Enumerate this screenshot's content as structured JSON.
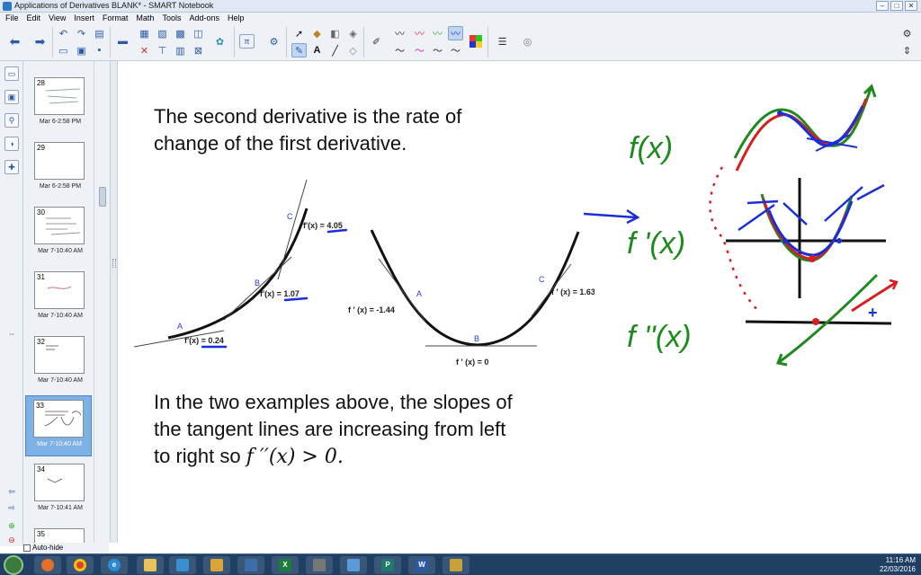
{
  "window": {
    "title": "Applications of Derivatives BLANK* - SMART Notebook",
    "buttons": [
      "–",
      "□",
      "✕"
    ]
  },
  "menu": {
    "items": [
      "File",
      "Edit",
      "View",
      "Insert",
      "Format",
      "Math",
      "Tools",
      "Add-ons",
      "Help"
    ]
  },
  "toolbar": {
    "tools": [
      "back",
      "forward",
      "undo",
      "redo",
      "add-page",
      "delete",
      "open",
      "save",
      "paste",
      "print",
      "screen-shade",
      "full-screen",
      "table",
      "capture",
      "math-tools",
      "insert",
      "select",
      "fill",
      "eraser-pen",
      "text",
      "line",
      "shapes",
      "pen",
      "calligraphic",
      "creative",
      "colors",
      "properties",
      "settings"
    ]
  },
  "sorter": {
    "pages": [
      {
        "num": "28",
        "time": "Mar 6-2:58 PM"
      },
      {
        "num": "29",
        "time": "Mar 6-2:58 PM"
      },
      {
        "num": "30",
        "time": "Mar 7-10:40 AM"
      },
      {
        "num": "31",
        "time": "Mar 7-10:40 AM"
      },
      {
        "num": "32",
        "time": "Mar 7-10:40 AM"
      },
      {
        "num": "33",
        "time": "Mar 7-10:40 AM"
      },
      {
        "num": "34",
        "time": "Mar 7-10:41 AM"
      },
      {
        "num": "35",
        "time": ""
      }
    ],
    "active_page": "33",
    "auto_hide": "Auto-hide"
  },
  "slide": {
    "heading_line1": "The second derivative is the rate of",
    "heading_line2": "change of the first derivative.",
    "graph1": {
      "label_a": "A",
      "label_b": "B",
      "label_c": "C",
      "slope_a": "f'(x) = 0.24",
      "slope_b": "f'(x) = 1.07",
      "slope_c": "f'(x) = 4.05"
    },
    "graph2": {
      "label_a": "A",
      "label_b": "B",
      "label_c": "C",
      "slope_a": "f ' (x) = -1.44",
      "slope_b": "f ' (x) = 0",
      "slope_c": "f ' (x) = 1.63"
    },
    "handwritten": {
      "f": "f(x)",
      "f_prime": "f '(x)",
      "f_double_prime": "f ''(x)",
      "plus": "+"
    },
    "bottom_line1": "In the two examples above, the slopes of",
    "bottom_line2": "the tangent lines are increasing from left",
    "bottom_line3_prefix": "to right so ",
    "bottom_math": "f ′′(x) > 0.",
    "ink_colors": {
      "blue": "#1b2fd6",
      "green": "#1e8a1e",
      "red": "#d61f1f"
    }
  },
  "taskbar": {
    "time": "11:16 AM",
    "date": "22/03/2016",
    "apps": [
      "firefox",
      "chrome",
      "ie",
      "explorer",
      "smart-apps",
      "notebook",
      "excel",
      "files",
      "notepad",
      "publisher",
      "word",
      "smart-ink"
    ]
  }
}
